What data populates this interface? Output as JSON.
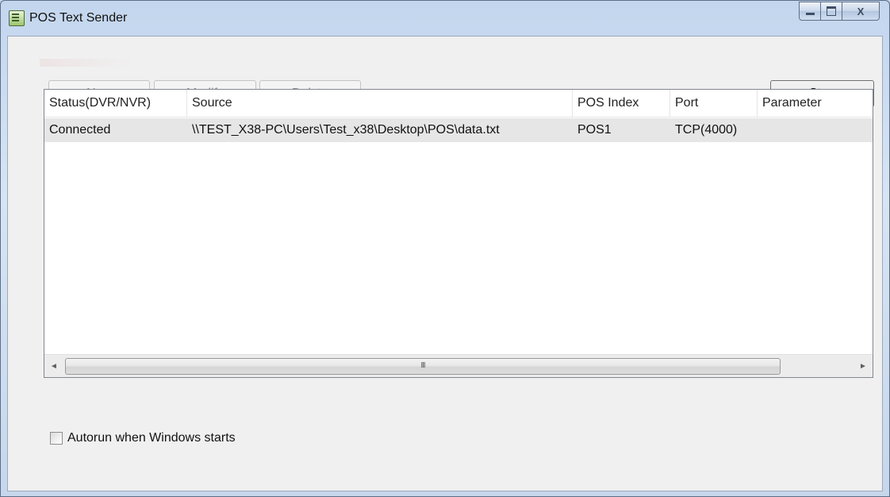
{
  "window": {
    "title": "POS Text Sender",
    "minimize_glyph": "",
    "maximize_glyph": "",
    "close_glyph": "X"
  },
  "toolbar": {
    "new_label": "New",
    "modify_label": "Modify",
    "delete_label": "Delete",
    "stop_label": "Stop"
  },
  "table": {
    "columns": [
      "Status(DVR/NVR)",
      "Source",
      "POS Index",
      "Port",
      "Parameter"
    ],
    "rows": [
      [
        "Connected",
        "\\\\TEST_X38-PC\\Users\\Test_x38\\Desktop\\POS\\data.txt",
        "POS1",
        "TCP(4000)",
        ""
      ]
    ],
    "scroll_left_glyph": "◄",
    "scroll_right_glyph": "►",
    "scroll_thumb_grip": "III"
  },
  "options": {
    "autorun_label": "Autorun when Windows starts",
    "autorun_checked": false
  },
  "icons": {
    "app": "pos-app-icon",
    "minimize": "minimize-icon",
    "maximize": "maximize-icon",
    "close": "close-icon"
  }
}
